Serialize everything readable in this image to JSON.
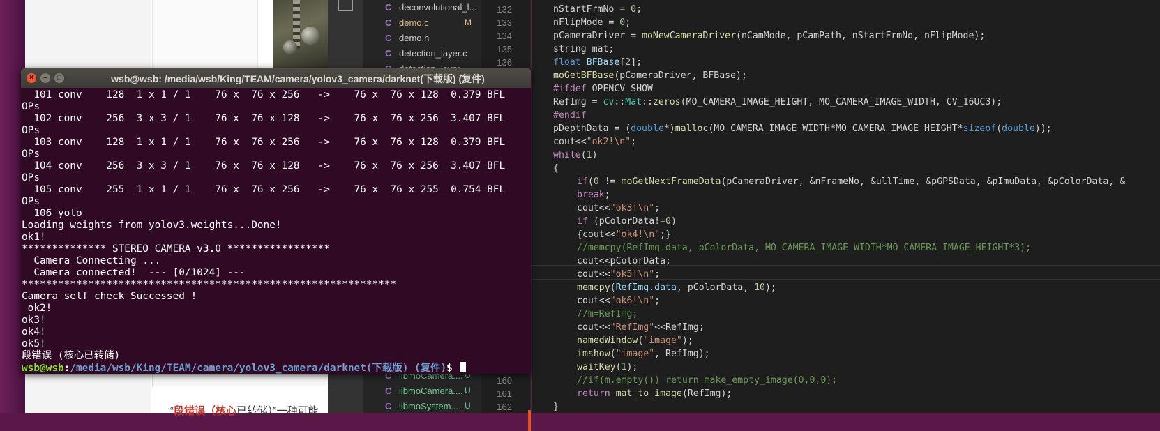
{
  "browser": {
    "text_red": "段错误（核心",
    "text_rest": "已转储）”一种可能"
  },
  "editor": {
    "files": [
      {
        "icon": "C",
        "name": "deconvolutional_l...",
        "badge": "",
        "color": "#cccccc"
      },
      {
        "icon": "C",
        "name": "demo.c",
        "badge": "M",
        "color": "#e2c08d"
      },
      {
        "icon": "C",
        "name": "demo.h",
        "badge": "",
        "color": "#cccccc"
      },
      {
        "icon": "C",
        "name": "detection_layer.c",
        "badge": "",
        "color": "#cccccc"
      },
      {
        "icon": "C",
        "name": "detection_layer...",
        "badge": "",
        "color": "#cccccc"
      }
    ],
    "files_bottom": [
      {
        "icon": "C",
        "name": "libmoCamera....",
        "badge": "U",
        "color": "#73c991"
      },
      {
        "icon": "C",
        "name": "libmoCamera....",
        "badge": "U",
        "color": "#73c991"
      },
      {
        "icon": "C",
        "name": "libmoSystem....",
        "badge": "U",
        "color": "#73c991"
      }
    ],
    "line_numbers_top": [
      "132",
      "133",
      "134",
      "135",
      "136"
    ],
    "line_numbers_bottom": [
      "160",
      "161",
      "162"
    ]
  },
  "terminal": {
    "title": "wsb@wsb: /media/wsb/King/TEAM/camera/yolov3_camera/darknet(下载版) (复件)",
    "close_glyph": "×",
    "min_glyph": "–",
    "max_glyph": "□",
    "lines": [
      "  101 conv    128  1 x 1 / 1    76 x  76 x 256   ->    76 x  76 x 128  0.379 BFL",
      "OPs",
      "  102 conv    256  3 x 3 / 1    76 x  76 x 128   ->    76 x  76 x 256  3.407 BFL",
      "OPs",
      "  103 conv    128  1 x 1 / 1    76 x  76 x 256   ->    76 x  76 x 128  0.379 BFL",
      "OPs",
      "  104 conv    256  3 x 3 / 1    76 x  76 x 128   ->    76 x  76 x 256  3.407 BFL",
      "OPs",
      "  105 conv    255  1 x 1 / 1    76 x  76 x 256   ->    76 x  76 x 255  0.754 BFL",
      "OPs",
      "  106 yolo",
      "Loading weights from yolov3.weights...Done!",
      "ok1!",
      "************** STEREO CAMERA v3.0 *****************",
      "  Camera Connecting ...",
      "  Camera connected!  --- [0/1024] ---",
      "**************************************************************",
      "Camera self check Successed !",
      " ok2!",
      "ok3!",
      "ok4!",
      "ok5!",
      "段错误 (核心已转储)"
    ],
    "prompt_user": "wsb@wsb",
    "prompt_sep": ":",
    "prompt_path": "/media/wsb/King/TEAM/camera/yolov3_camera/darknet(下载版) (复件)",
    "prompt_symbol": "$ "
  }
}
